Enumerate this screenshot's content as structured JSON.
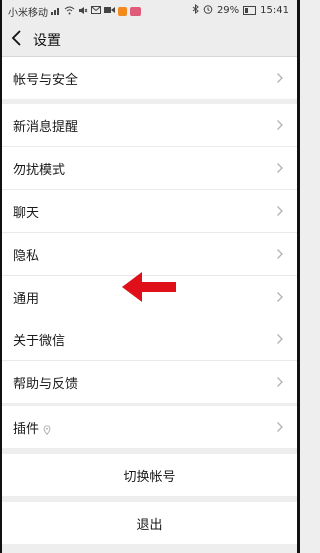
{
  "status_bar": {
    "carrier": "小米移动",
    "battery": "29%",
    "time": "15:41",
    "battery_fraction": 0.29,
    "left_icons": [
      "signal-icon",
      "wifi-icon",
      "mute-icon",
      "email-icon",
      "video-icon",
      "orange-app-icon",
      "pink-app-icon"
    ],
    "right_icons": [
      "bluetooth-icon",
      "alarm-icon",
      "battery-icon"
    ]
  },
  "header": {
    "title": "设置",
    "back_icon": "chevron-left-icon"
  },
  "groups": {
    "account": [
      {
        "label": "帐号与安全"
      }
    ],
    "main": [
      {
        "label": "新消息提醒"
      },
      {
        "label": "勿扰模式"
      },
      {
        "label": "聊天"
      },
      {
        "label": "隐私"
      },
      {
        "label": "通用"
      }
    ],
    "about": [
      {
        "label": "关于微信"
      },
      {
        "label": "帮助与反馈"
      }
    ],
    "plugins": [
      {
        "label": "插件"
      }
    ]
  },
  "actions": {
    "switch_account": "切换帐号",
    "logout": "退出"
  },
  "annotation": {
    "arrow_color": "#e0101a"
  },
  "colors": {
    "background": "#eeeeee",
    "row": "#ffffff",
    "text": "#1a1a1a",
    "chevron": "#b2b2b2"
  }
}
